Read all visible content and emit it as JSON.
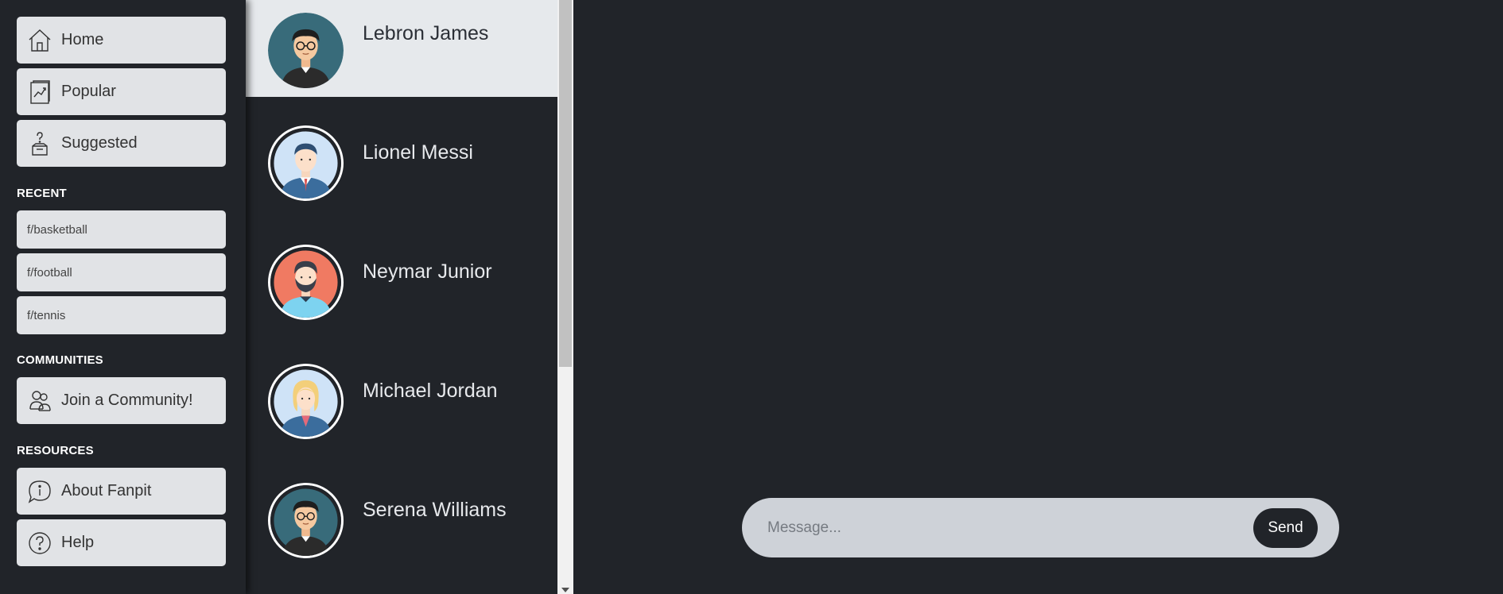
{
  "sidebar": {
    "nav": [
      {
        "label": "Home",
        "icon": "home-icon"
      },
      {
        "label": "Popular",
        "icon": "trending-chart-icon"
      },
      {
        "label": "Suggested",
        "icon": "question-box-icon"
      }
    ],
    "recent_heading": "RECENT",
    "recent": [
      "f/basketball",
      "f/football",
      "f/tennis"
    ],
    "communities_heading": "COMMUNITIES",
    "join_community": {
      "label": "Join a Community!",
      "icon": "people-icon"
    },
    "resources_heading": "RESOURCES",
    "resources": [
      {
        "label": "About Fanpit",
        "icon": "info-chat-icon"
      },
      {
        "label": "Help",
        "icon": "help-circle-icon"
      }
    ]
  },
  "contacts": [
    {
      "name": "Lebron James",
      "avatar": "man-glasses-teal-avatar",
      "active": true
    },
    {
      "name": "Lionel Messi",
      "avatar": "man-suit-blue-avatar",
      "active": false
    },
    {
      "name": "Neymar Junior",
      "avatar": "man-beard-coral-avatar",
      "active": false
    },
    {
      "name": "Michael Jordan",
      "avatar": "woman-blonde-blue-avatar",
      "active": false
    },
    {
      "name": "Serena Williams",
      "avatar": "man-glasses-teal-avatar",
      "active": false
    }
  ],
  "chat": {
    "message_placeholder": "Message...",
    "send_label": "Send"
  },
  "colors": {
    "background": "#212429",
    "button_bg": "#e1e3e6",
    "active_contact_bg": "#e6e9ec",
    "message_bar_bg": "#ced2d8"
  }
}
